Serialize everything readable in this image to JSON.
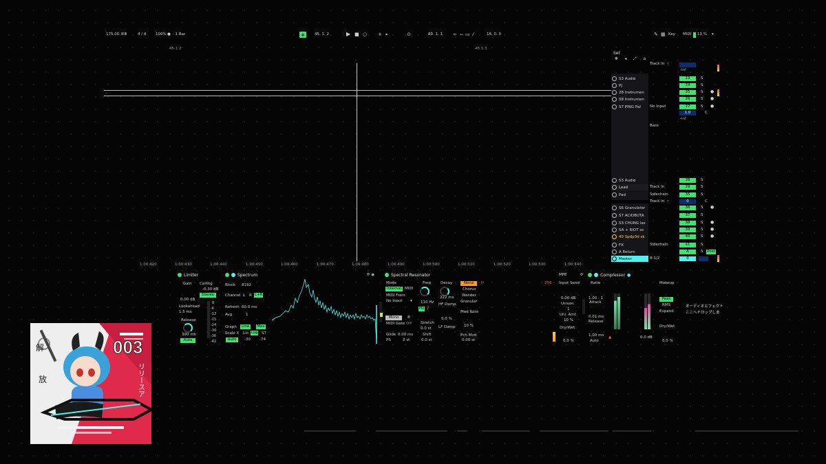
{
  "transport": {
    "tempo": "175.00",
    "tap": "III III",
    "signature": "4 / 4",
    "zoom": "100%",
    "record_quant": "1 Bar",
    "position": "45.  1.  2",
    "loop_start": "89.  1.  1",
    "loop_length": "16.  0.  0",
    "key_label": "Key",
    "midi_label": "MIDI",
    "cpu": "13 %"
  },
  "arrangement": {
    "markers": [
      "45.1.2",
      "45.1.3"
    ],
    "clip_label": "···",
    "timeline": [
      "1:00:420",
      "1:00:430",
      "1:00:440",
      "1:00:450",
      "1:00:460",
      "1:00:470",
      "1:00:480",
      "1:00:490",
      "1:00:500",
      "1:00:510",
      "1:00:520",
      "1:00:530",
      "1:00:540"
    ]
  },
  "mixer": {
    "set_label": "Set",
    "labels": {
      "track_in": "Track In",
      "no_input": "No Input",
      "bass": "Bass",
      "sidechain": "Sidechain",
      "neg_inf": "-inf",
      "s": "S",
      "c": "C",
      "a": "A",
      "b12": "B 1/2",
      "post": "Post",
      "one": "1.0"
    },
    "tracks_top": [
      {
        "name": "S3 Audio",
        "vol": "23"
      },
      {
        "name": "PJ",
        "vol": "24"
      },
      {
        "name": "28 Instrumen",
        "vol": "25"
      },
      {
        "name": "S8 Instrumen",
        "vol": "26"
      },
      {
        "name": "S7 PING PaI",
        "vol": "27"
      }
    ],
    "tracks_mid": [
      {
        "name": "S3 Audio",
        "vol": "28"
      },
      {
        "name": "Lead",
        "vol": "29"
      },
      {
        "name": "Pad",
        "vol": "35"
      }
    ],
    "tracks_bottom": [
      {
        "name": "S6 Granulator",
        "vol": "36"
      },
      {
        "name": "S7 ACIDBUTA",
        "vol": "37"
      },
      {
        "name": "S3 CHUNG las",
        "vol": "38"
      },
      {
        "name": "SA + RIOT ss",
        "vol": "39"
      },
      {
        "name": "40 Spdp3d sk",
        "vol": "40"
      },
      {
        "name": "FX",
        "vol": "41"
      },
      {
        "name": "A Return",
        "vol": "A"
      }
    ],
    "master": {
      "name": "Master",
      "vol": "0"
    }
  },
  "devices": {
    "limiter": {
      "title": "Limiter",
      "gain": "Gain",
      "ceiling": "Ceiling",
      "ceiling_val": "-0.30 dB",
      "stereo": "Stereo",
      "gain_val": "0.00 dB",
      "lookahead": "Lookahead",
      "lookahead_val": "1.5 ms",
      "release": "Release",
      "release_val": "300 ms",
      "auto": "Auto",
      "scale": [
        "0",
        "-6",
        "-12",
        "-15",
        "-24",
        "-30",
        "-36",
        "-42"
      ]
    },
    "spectrum": {
      "title": "Spectrum",
      "block": "Block",
      "block_val": "8192",
      "channel": "Channel",
      "ch_l": "L",
      "ch_r": "R",
      "ch_lr": "L+R",
      "refresh": "Refresh",
      "refresh_val": "60.0 ms",
      "avg": "Avg",
      "avg_val": "1",
      "graph": "Graph",
      "line": "Line",
      "max": "Max",
      "scale_x": "Scale X",
      "lin": "Lin",
      "log": "Log",
      "st": "ST",
      "auto": "Auto",
      "range_lo": "-30",
      "range_hi": "-74"
    },
    "resonator": {
      "title": "Spectral Resonator",
      "mode": "Mode",
      "internal": "Internal",
      "midi": "MIDI",
      "midi_from": "MIDI From",
      "no_input": "No Input",
      "freq": "Freq",
      "freq_val": "110 Hz",
      "decay": "Decay",
      "decay_val": "222 ms",
      "hf_damp": "HF Damp",
      "lf_damp": "LF Damp",
      "none": "None",
      "chorus": "Chorus",
      "wander": "Wander",
      "granular": "Granular",
      "mono": "Mono",
      "voices": "8",
      "midi_gate": "MIDI Gate",
      "off": "Off",
      "stretch": "Stretch",
      "stretch_val": "0.0 st",
      "mod_rate": "Mod Rate",
      "mod_rate_val": "10 %",
      "glide": "Glide",
      "glide_val": "0.00 ms",
      "shift": "Shift",
      "shift_val": "0.0 st",
      "ps": "PS",
      "ps_val": "2 st",
      "pch_mod": "Pch Mod",
      "pch_mod_val": "0.00 st",
      "damp_val": "0.0 %",
      "q_val": "256"
    },
    "compressor": {
      "title": "Compressor",
      "mpe": "MPE",
      "input_send": "Input Send",
      "input_val": "0.00 dB",
      "unison": "Unison",
      "unison_val": "1",
      "uni_amt": "Uni. Amt",
      "uni_amt_val": "10 %",
      "dry_wet": "Dry/Wet",
      "dry_wet_val": "0.0 %",
      "ratio": "Ratio",
      "ratio_val": "1.00 : 1",
      "attack": "Attack",
      "attack_val": "0.01 ms",
      "release": "Release",
      "release_val": "1.00 ms",
      "auto": "Auto",
      "makeup": "Makeup",
      "peak": "Peak",
      "rms": "RMS",
      "expand": "Expand",
      "dry_wet2": "Dry/Wet",
      "dry_wet2_val": "0.0 %",
      "out_val": "0.0 dB"
    },
    "drop_hint": [
      "オーディオエフェクト",
      "ここへドロップしま"
    ]
  },
  "album": {
    "number": "003",
    "kana": "リリースア",
    "kanji_top": "解",
    "kanji_bottom": "放"
  },
  "colors": {
    "accent_green": "#3fe26f",
    "accent_cyan": "#4df3ee",
    "accent_orange": "#ff9a1f",
    "album_red": "#e02a4b"
  }
}
